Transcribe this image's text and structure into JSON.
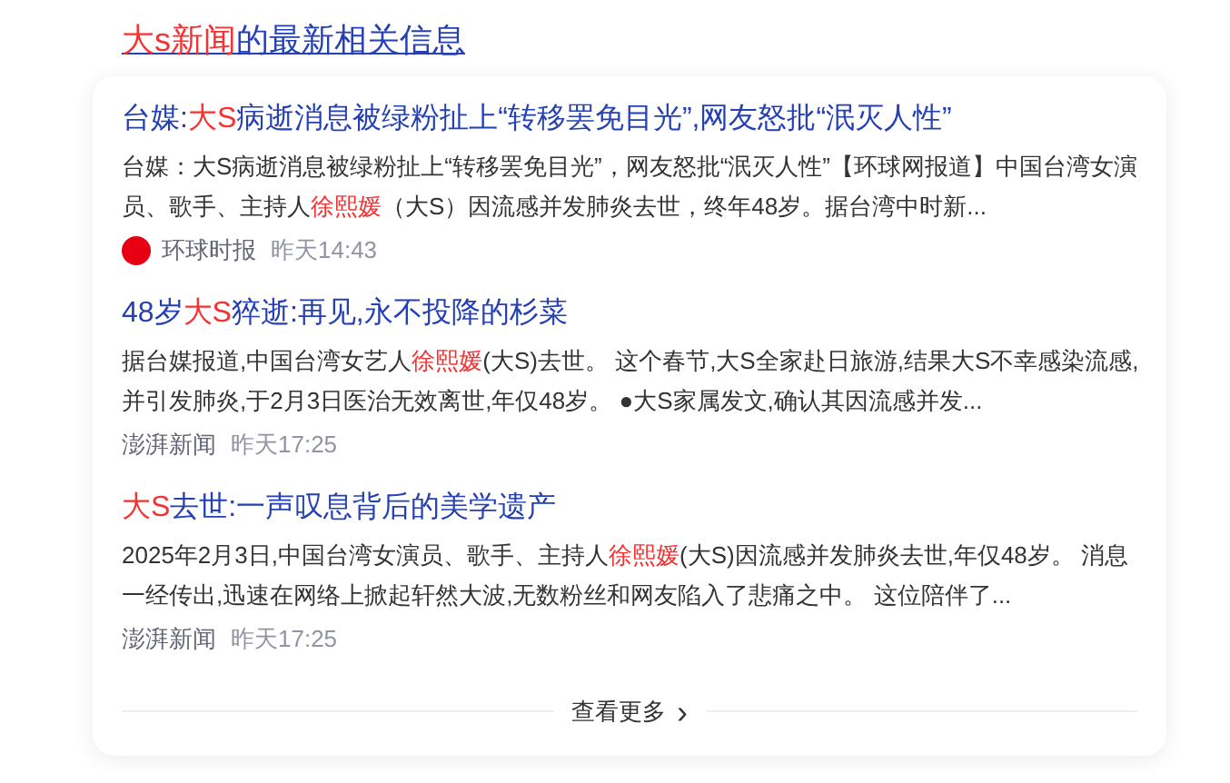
{
  "heading": [
    {
      "text": "大s新闻",
      "highlight": true
    },
    {
      "text": "的最新相关信息",
      "highlight": false
    }
  ],
  "articles": [
    {
      "title": [
        {
          "text": "台媒:",
          "highlight": false
        },
        {
          "text": "大S",
          "highlight": true
        },
        {
          "text": "病逝消息被绿粉扯上“转移罢免目光”,网友怒批“泯灭人性”",
          "highlight": false
        }
      ],
      "snippet": [
        {
          "text": "台媒：大S病逝消息被绿粉扯上“转移罢免目光”，网友怒批“泯灭人性”【环球网报道】中国台湾女演员、歌手、主持人",
          "highlight": false
        },
        {
          "text": "徐熙媛",
          "highlight": true
        },
        {
          "text": "（大S）因流感并发肺炎去世，终年48岁。据台湾中时新...",
          "highlight": false
        }
      ],
      "source": "环球时报",
      "source_logo": true,
      "time": "昨天14:43"
    },
    {
      "title": [
        {
          "text": "48岁",
          "highlight": false
        },
        {
          "text": "大S",
          "highlight": true
        },
        {
          "text": "猝逝:再见,永不投降的杉菜",
          "highlight": false
        }
      ],
      "snippet": [
        {
          "text": "据台媒报道,中国台湾女艺人",
          "highlight": false
        },
        {
          "text": "徐熙媛",
          "highlight": true
        },
        {
          "text": "(大S)去世。 这个春节,大S全家赴日旅游,结果大S不幸感染流感,并引发肺炎,于2月3日医治无效离世,年仅48岁。 ●大S家属发文,确认其因流感并发...",
          "highlight": false
        }
      ],
      "source": "澎湃新闻",
      "source_logo": false,
      "time": "昨天17:25"
    },
    {
      "title": [
        {
          "text": "大S",
          "highlight": true
        },
        {
          "text": "去世:一声叹息背后的美学遗产",
          "highlight": false
        }
      ],
      "snippet": [
        {
          "text": "2025年2月3日,中国台湾女演员、歌手、主持人",
          "highlight": false
        },
        {
          "text": "徐熙媛",
          "highlight": true
        },
        {
          "text": "(大S)因流感并发肺炎去世,年仅48岁。 消息一经传出,迅速在网络上掀起轩然大波,无数粉丝和网友陷入了悲痛之中。 这位陪伴了...",
          "highlight": false
        }
      ],
      "source": "澎湃新闻",
      "source_logo": false,
      "time": "昨天17:25"
    }
  ],
  "more_button": {
    "label": "查看更多",
    "arrow": "›"
  }
}
